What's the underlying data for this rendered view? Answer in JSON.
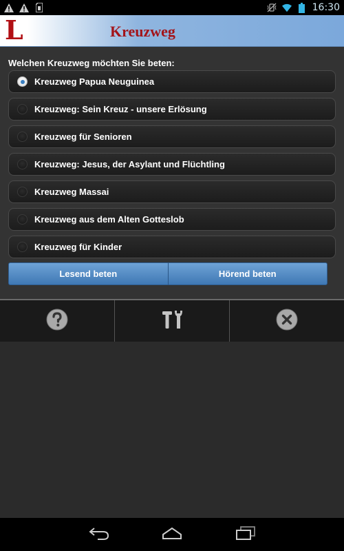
{
  "status_bar": {
    "time": "16:30",
    "left_icons": [
      "warning-icon",
      "warning-icon",
      "sd-card-icon"
    ],
    "right_icons": [
      "vibrate-icon",
      "wifi-icon",
      "battery-icon"
    ]
  },
  "app": {
    "logo_letter": "L",
    "title": "Kreuzweg",
    "accent_color": "#a3141a",
    "header_gradient": [
      "#ffffff",
      "#7ba8db"
    ]
  },
  "form": {
    "question": "Welchen Kreuzweg möchten Sie beten:",
    "options": [
      {
        "label": "Kreuzweg Papua Neuguinea",
        "checked": true
      },
      {
        "label": "Kreuzweg: Sein Kreuz - unsere Erlösung",
        "checked": false
      },
      {
        "label": "Kreuzweg für Senioren",
        "checked": false
      },
      {
        "label": "Kreuzweg: Jesus, der Asylant und Flüchtling",
        "checked": false
      },
      {
        "label": "Kreuzweg Massai",
        "checked": false
      },
      {
        "label": "Kreuzweg aus dem Alten Gotteslob",
        "checked": false
      },
      {
        "label": "Kreuzweg für Kinder",
        "checked": false
      }
    ],
    "buttons": {
      "read_label": "Lesend beten",
      "listen_label": "Hörend beten"
    }
  },
  "toolbar": {
    "items": [
      "help-icon",
      "tools-icon",
      "close-icon"
    ]
  },
  "nav": {
    "items": [
      "back-icon",
      "home-icon",
      "recent-apps-icon"
    ]
  }
}
